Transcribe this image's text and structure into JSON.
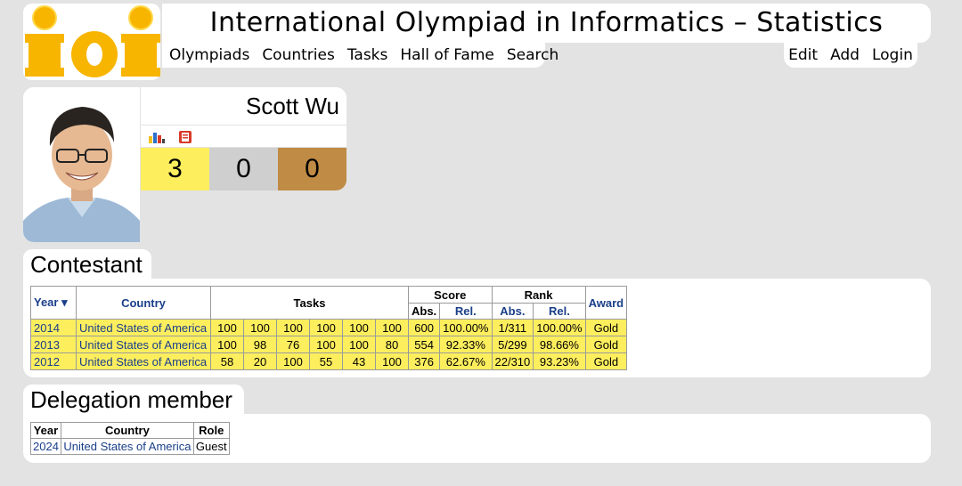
{
  "header": {
    "logo_text": "ioi",
    "title": "International Olympiad in Informatics – Statistics",
    "nav_left": [
      "Olympiads",
      "Countries",
      "Tasks",
      "Hall of Fame",
      "Search"
    ],
    "nav_right": [
      "Edit",
      "Add",
      "Login"
    ]
  },
  "person": {
    "name": "Scott Wu",
    "icons": [
      "bar-chart-icon",
      "profile-card-icon"
    ],
    "medals": {
      "gold": "3",
      "silver": "0",
      "bronze": "0"
    }
  },
  "contestant": {
    "heading": "Contestant",
    "headers": {
      "year": "Year ▾",
      "country": "Country",
      "tasks": "Tasks",
      "score": "Score",
      "rank": "Rank",
      "abs": "Abs.",
      "rel": "Rel.",
      "award": "Award"
    },
    "rows": [
      {
        "year": "2014",
        "country": "United States of America",
        "tasks": [
          "100",
          "100",
          "100",
          "100",
          "100",
          "100"
        ],
        "score_abs": "600",
        "score_rel": "100.00%",
        "rank_abs": "1/311",
        "rank_rel": "100.00%",
        "award": "Gold"
      },
      {
        "year": "2013",
        "country": "United States of America",
        "tasks": [
          "100",
          "98",
          "76",
          "100",
          "100",
          "80"
        ],
        "score_abs": "554",
        "score_rel": "92.33%",
        "rank_abs": "5/299",
        "rank_rel": "98.66%",
        "award": "Gold"
      },
      {
        "year": "2012",
        "country": "United States of America",
        "tasks": [
          "58",
          "20",
          "100",
          "55",
          "43",
          "100"
        ],
        "score_abs": "376",
        "score_rel": "62.67%",
        "rank_abs": "22/310",
        "rank_rel": "93.23%",
        "award": "Gold"
      }
    ]
  },
  "delegation": {
    "heading": "Delegation member",
    "headers": {
      "year": "Year",
      "country": "Country",
      "role": "Role"
    },
    "rows": [
      {
        "year": "2024",
        "country": "United States of America",
        "role": "Guest"
      }
    ]
  },
  "colors": {
    "gold": "#fdee5e",
    "silver": "#cfcfcf",
    "bronze": "#c08b45",
    "link": "#1a3f8a",
    "background": "#e3e3e3"
  }
}
